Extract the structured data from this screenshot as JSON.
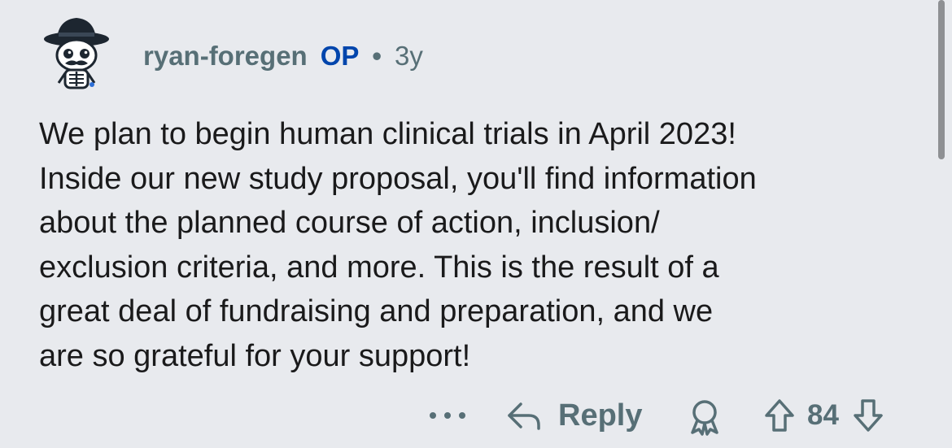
{
  "comment": {
    "author": "ryan-foregen",
    "op_badge": "OP",
    "separator": "•",
    "age": "3y",
    "text": "We plan to begin human clinical trials in April 2023!\nInside our new study proposal, you'll find information\nabout the planned course of action, inclusion/\nexclusion criteria, and more. This is the result of a\ngreat deal of fundraising and preparation, and we\nare so grateful for your support!"
  },
  "actions": {
    "reply_label": "Reply",
    "vote_count": "84",
    "more_icon": "ellipsis-icon",
    "reply_icon": "reply-arrow-icon",
    "award_icon": "award-icon",
    "upvote_icon": "upvote-arrow-icon",
    "downvote_icon": "downvote-arrow-icon"
  },
  "colors": {
    "background": "#e8eaee",
    "text": "#1a1a1b",
    "muted": "#576f76",
    "op_accent": "#0045ac"
  }
}
